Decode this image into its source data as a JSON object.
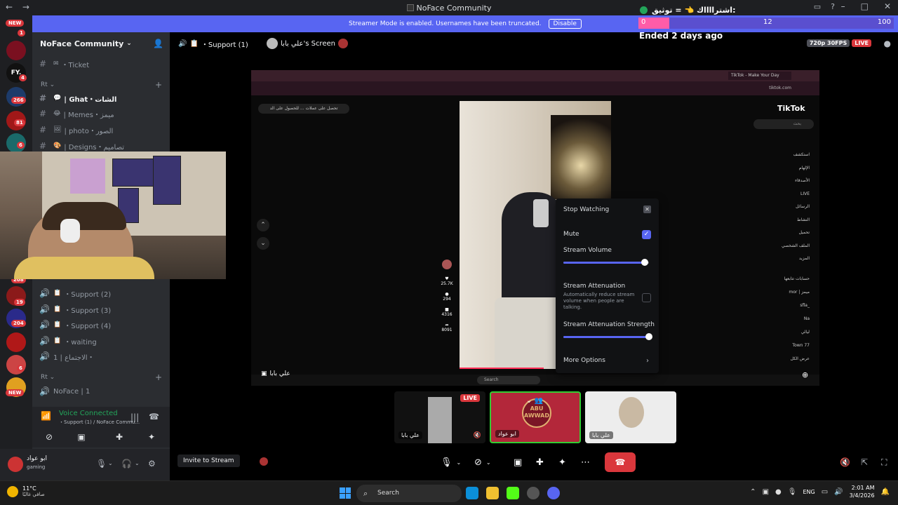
{
  "window": {
    "title": "NoFace Community",
    "back": "←",
    "forward": "→"
  },
  "banner": {
    "text": "Streamer Mode is enabled. Usernames have been truncated.",
    "button": "Disable"
  },
  "overlay": {
    "title": "اشترااااك 👈 = توثيق:",
    "progress_min": "0",
    "progress_current": "12",
    "progress_max": "100",
    "progress_fraction": 0.12,
    "ended": "Ended 2 days ago"
  },
  "rail": {
    "new_top": "NEW",
    "new_bottom": "NEW",
    "servers": [
      {
        "badge": "1"
      },
      {
        "label": "FY.",
        "badge": "4"
      },
      {
        "badge": "266"
      },
      {
        "badge": "81"
      },
      {
        "badge": "6"
      },
      {
        "badge": "208"
      },
      {
        "badge": "19"
      },
      {
        "badge": "204"
      },
      {
        "badge": ""
      },
      {
        "badge": "6"
      }
    ]
  },
  "sidebar": {
    "guild_name": "NoFace Community",
    "channels_top": [
      {
        "emoji": "✉",
        "name": "・Ticket"
      },
      {
        "emoji": "💬",
        "name": "| Ghat・الشات",
        "bold": true
      },
      {
        "emoji": "😂",
        "name": "| Memes・ميمز"
      },
      {
        "emoji": "🖼",
        "name": "| photo・الصور"
      },
      {
        "emoji": "🎨",
        "name": "| Designs・تصاميم"
      }
    ],
    "category1": "Rt",
    "voice_channels": [
      {
        "name": "・Support (2)"
      },
      {
        "name": "・Support (3)"
      },
      {
        "name": "・Support (4)"
      },
      {
        "name": "・waiting"
      },
      {
        "name": "1 | الاجتماع・"
      }
    ],
    "category2": "Rt",
    "noface_channel": "NoFace | 1",
    "voice_status": {
      "connected": "Voice Connected",
      "location": "・Support (1)  / NoFace Commu..."
    },
    "user": {
      "name": "ابو عواد",
      "status": "gaming"
    }
  },
  "stage": {
    "channel": "・Support (1)",
    "screen_owner": "علي بابا's Screen",
    "quality": "720p 30FPS",
    "live": "LIVE"
  },
  "stream_screen": {
    "tab_title": "TikTok - Make Your Day",
    "url": "tiktok.com",
    "tiktok": "TikTok",
    "search_hint": "بحث",
    "tip": "تحصل على عملات ... للحصول على الد",
    "nav": [
      "استكشف",
      "الإلهام",
      "الأصدقاء",
      "LIVE",
      "الرسائل",
      "النشاط",
      "تحميل",
      "الملف الشخصي",
      "المزيد"
    ],
    "following_title": "حسابات تتابعها",
    "following": [
      "mor | ميمز",
      "sfla_",
      "Na",
      "ليالي",
      "Town 77",
      "عرض الكل"
    ],
    "side_counts": [
      "25.7K",
      "294",
      "4316",
      "8091"
    ],
    "taskbar_search": "Search",
    "streamer_label": "علي بابا"
  },
  "popup": {
    "stop_watching": "Stop Watching",
    "mute": "Mute",
    "mute_checked": true,
    "volume_label": "Stream Volume",
    "volume_level": 0.95,
    "attenuation": "Stream Attenuation",
    "attenuation_desc": "Automatically reduce stream volume when people are talking.",
    "attenuation_checked": false,
    "strength_label": "Stream Attenuation Strength",
    "strength_level": 1.0,
    "more_options": "More Options"
  },
  "tiles": [
    {
      "name": "علي بابا",
      "live": "LIVE"
    },
    {
      "name": "ابو عواد",
      "logo": "ABU AWWAD"
    },
    {
      "name": "علي بابا"
    }
  ],
  "controls": {
    "invite": "Invite to Stream"
  },
  "taskbar": {
    "temp": "11°C",
    "weather": "صافي غالبًا",
    "search": "Search",
    "lang": "ENG",
    "time": "2:01 AM",
    "date": "3/4/2026"
  },
  "colors": {
    "accent": "#5865f2",
    "danger": "#da373c",
    "online": "#23a55a",
    "progress_fill": "#ff5ca8"
  }
}
